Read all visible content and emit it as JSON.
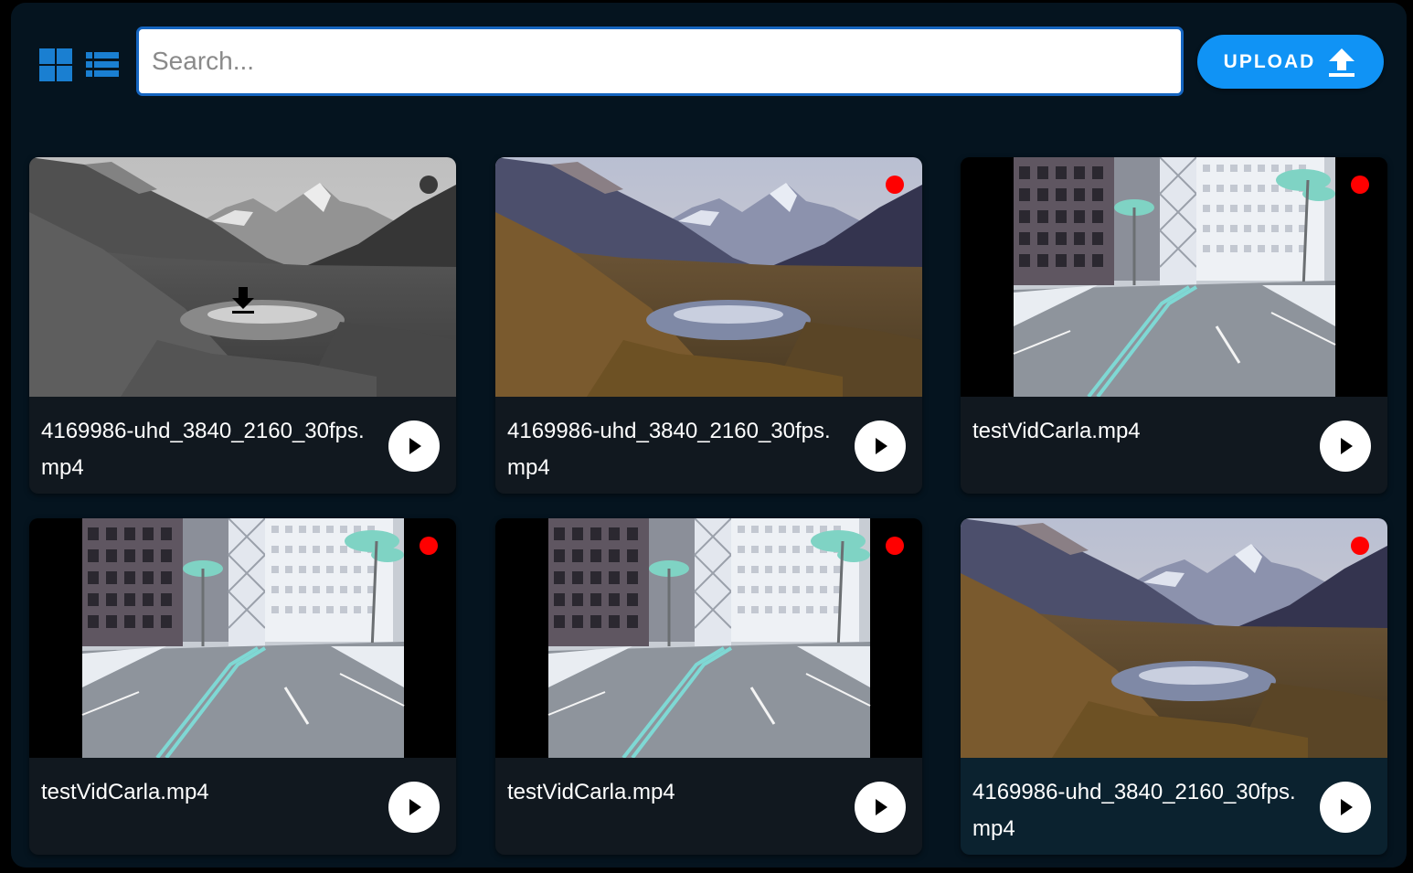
{
  "toolbar": {
    "grid_view_icon": "grid-view-icon",
    "list_view_icon": "list-view-icon",
    "search_placeholder": "Search...",
    "upload_label": "UPLOAD",
    "upload_icon": "upload-icon",
    "accent_color": "#1093f5"
  },
  "videos": [
    {
      "title": "4169986-uhd_3840_2160_30fps.mp4",
      "thumb": "mountain-lake",
      "grayscale": true,
      "recording_dot": "#3a3a3a",
      "downloading": true,
      "selected": false
    },
    {
      "title": "4169986-uhd_3840_2160_30fps.mp4",
      "thumb": "mountain-lake",
      "grayscale": false,
      "recording_dot": "#ff0000",
      "downloading": false,
      "selected": false
    },
    {
      "title": "testVidCarla.mp4",
      "thumb": "city-road",
      "grayscale": false,
      "recording_dot": "#ff0000",
      "downloading": false,
      "selected": false
    },
    {
      "title": "testVidCarla.mp4",
      "thumb": "city-road",
      "grayscale": false,
      "recording_dot": "#ff0000",
      "downloading": false,
      "selected": false
    },
    {
      "title": "testVidCarla.mp4",
      "thumb": "city-road",
      "grayscale": false,
      "recording_dot": "#ff0000",
      "downloading": false,
      "selected": false
    },
    {
      "title": "4169986-uhd_3840_2160_30fps.mp4",
      "thumb": "mountain-lake",
      "grayscale": false,
      "recording_dot": "#ff0000",
      "downloading": false,
      "selected": true
    }
  ]
}
